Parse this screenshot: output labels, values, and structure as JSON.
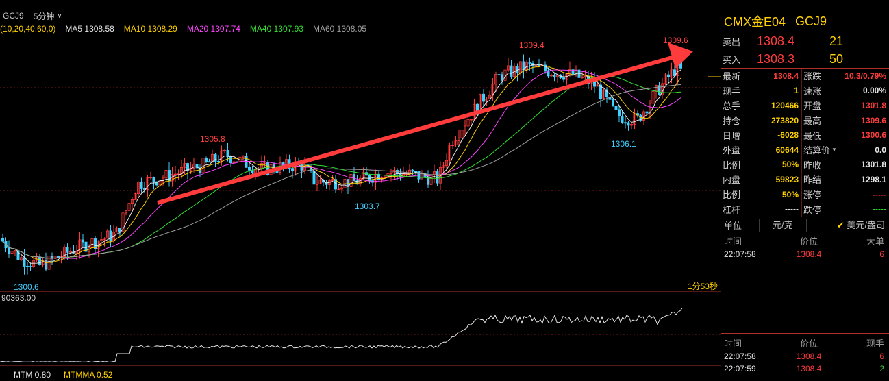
{
  "topbar": {
    "symbol": "GCJ9",
    "period": "5分钟"
  },
  "ma_line": [
    {
      "label": "(10,20,40,60,0)",
      "color": "#ffd200"
    },
    {
      "label": "MA5 1308.58",
      "color": "#e8e8e8"
    },
    {
      "label": "MA10 1308.29",
      "color": "#ffd200"
    },
    {
      "label": "MA20 1307.74",
      "color": "#ff44ff"
    },
    {
      "label": "MA40 1307.93",
      "color": "#33e033"
    },
    {
      "label": "MA60 1308.05",
      "color": "#a0a0a0"
    }
  ],
  "chart_data": {
    "type": "candlestick",
    "price_range": [
      1300.0,
      1310.0
    ],
    "annotations": [
      {
        "text": "1309.4",
        "color": "#ff4040"
      },
      {
        "text": "1309.6",
        "color": "#ff4040"
      },
      {
        "text": "1305.8",
        "color": "#ff4040"
      },
      {
        "text": "1303.7",
        "color": "#40d0ff"
      },
      {
        "text": "1306.1",
        "color": "#40d0ff"
      },
      {
        "text": "1300.6",
        "color": "#40d0ff"
      }
    ],
    "countdown": "1分53秒",
    "sub_value": "90363.00",
    "mtm": "MTM 0.80",
    "mtmma": "MTMMA 0.52"
  },
  "panel": {
    "title_left": "CMX金E04",
    "title_right": "GCJ9",
    "sell_label": "卖出",
    "sell_price": "1308.4",
    "sell_vol": "21",
    "buy_label": "买入",
    "buy_price": "1308.3",
    "buy_vol": "50",
    "left_rows": [
      {
        "k": "最新",
        "v": "1308.4",
        "c": "red"
      },
      {
        "k": "现手",
        "v": "1",
        "c": "yel"
      },
      {
        "k": "总手",
        "v": "120466",
        "c": "yel"
      },
      {
        "k": "持仓",
        "v": "273820",
        "c": "yel"
      },
      {
        "k": "日增",
        "v": "-6028",
        "c": "yel"
      },
      {
        "k": "外盘",
        "v": "60644",
        "c": "yel"
      },
      {
        "k": "比例",
        "v": "50%",
        "c": "yel"
      },
      {
        "k": "内盘",
        "v": "59823",
        "c": "yel"
      },
      {
        "k": "比例",
        "v": "50%",
        "c": "yel"
      },
      {
        "k": "杠杆",
        "v": "-----",
        "c": "wht"
      }
    ],
    "right_rows": [
      {
        "k": "涨跌",
        "v": "10.3/0.79%",
        "c": "red"
      },
      {
        "k": "速涨",
        "v": "0.00%",
        "c": "wht"
      },
      {
        "k": "开盘",
        "v": "1301.8",
        "c": "red"
      },
      {
        "k": "最高",
        "v": "1309.6",
        "c": "red"
      },
      {
        "k": "最低",
        "v": "1300.6",
        "c": "red"
      },
      {
        "k": "结算价",
        "v": "0.0",
        "c": "wht"
      },
      {
        "k": "昨收",
        "v": "1301.8",
        "c": "wht"
      },
      {
        "k": "昨结",
        "v": "1298.1",
        "c": "wht"
      },
      {
        "k": "涨停",
        "v": "-----",
        "c": "red"
      },
      {
        "k": "跌停",
        "v": "-----",
        "c": "grn"
      }
    ],
    "unit_label": "单位",
    "unit_a": "元/克",
    "unit_b": "美元/盎司",
    "tick1_headers": [
      "时间",
      "价位",
      "大单"
    ],
    "tick1_rows": [
      [
        "22:07:58",
        "1308.4",
        "6"
      ]
    ],
    "tick2_headers": [
      "时间",
      "价位",
      "现手"
    ],
    "tick2_rows": [
      [
        "22:07:58",
        "1308.4",
        "6"
      ],
      [
        "22:07:59",
        "1308.4",
        "2"
      ]
    ]
  }
}
